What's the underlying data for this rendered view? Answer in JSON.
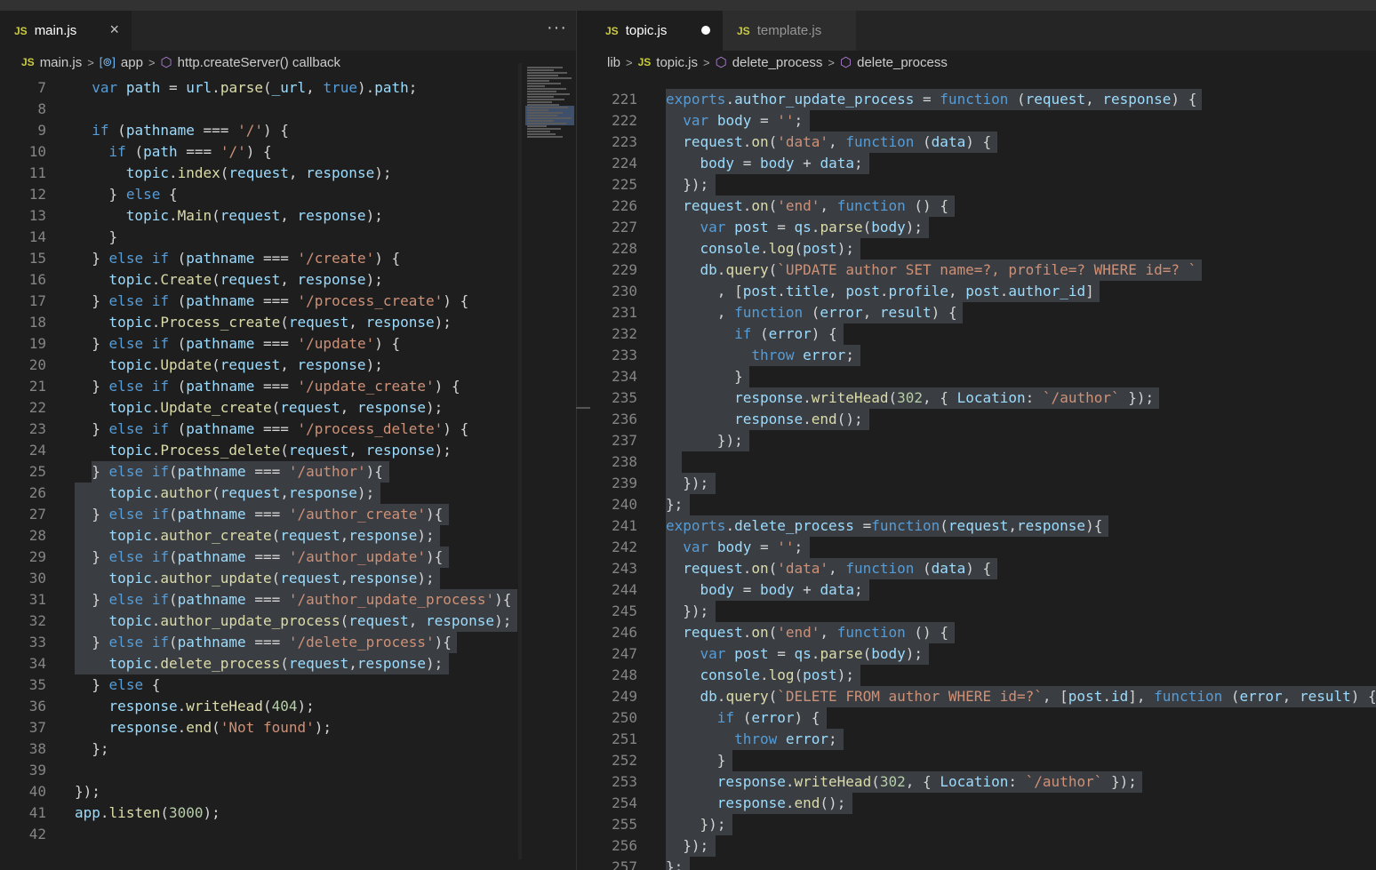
{
  "editor": {
    "left": {
      "tabs": [
        {
          "label": "main.js",
          "active": true,
          "icon": "js-file-icon",
          "close": "×"
        }
      ],
      "more_actions": "···",
      "breadcrumb": [
        "main.js",
        "app",
        "http.createServer() callback"
      ],
      "lines": [
        {
          "n": "7",
          "t": "  var path = url.parse(_url, true).path;"
        },
        {
          "n": "8",
          "t": ""
        },
        {
          "n": "9",
          "t": "  if (pathname === '/') {"
        },
        {
          "n": "10",
          "t": "    if (path === '/') {"
        },
        {
          "n": "11",
          "t": "      topic.index(request, response);"
        },
        {
          "n": "12",
          "t": "    } else {"
        },
        {
          "n": "13",
          "t": "      topic.Main(request, response);"
        },
        {
          "n": "14",
          "t": "    }"
        },
        {
          "n": "15",
          "t": "  } else if (pathname === '/create') {"
        },
        {
          "n": "16",
          "t": "    topic.Create(request, response);"
        },
        {
          "n": "17",
          "t": "  } else if (pathname === '/process_create') {"
        },
        {
          "n": "18",
          "t": "    topic.Process_create(request, response);"
        },
        {
          "n": "19",
          "t": "  } else if (pathname === '/update') {"
        },
        {
          "n": "20",
          "t": "    topic.Update(request, response);"
        },
        {
          "n": "21",
          "t": "  } else if (pathname === '/update_create') {"
        },
        {
          "n": "22",
          "t": "    topic.Update_create(request, response);"
        },
        {
          "n": "23",
          "t": "  } else if (pathname === '/process_delete') {"
        },
        {
          "n": "24",
          "t": "    topic.Process_delete(request, response);"
        },
        {
          "n": "25",
          "t": "  } else if(pathname === '/author'){"
        },
        {
          "n": "26",
          "t": "    topic.author(request,response);"
        },
        {
          "n": "27",
          "t": "  } else if(pathname === '/author_create'){"
        },
        {
          "n": "28",
          "t": "    topic.author_create(request,response);"
        },
        {
          "n": "29",
          "t": "  } else if(pathname === '/author_update'){"
        },
        {
          "n": "30",
          "t": "    topic.author_update(request,response);"
        },
        {
          "n": "31",
          "t": "  } else if(pathname === '/author_update_process'){"
        },
        {
          "n": "32",
          "t": "    topic.author_update_process(request, response);"
        },
        {
          "n": "33",
          "t": "  } else if(pathname === '/delete_process'){"
        },
        {
          "n": "34",
          "t": "    topic.delete_process(request,response);"
        },
        {
          "n": "35",
          "t": "  } else {"
        },
        {
          "n": "36",
          "t": "    response.writeHead(404);"
        },
        {
          "n": "37",
          "t": "    response.end('Not found');"
        },
        {
          "n": "38",
          "t": "  };"
        },
        {
          "n": "39",
          "t": ""
        },
        {
          "n": "40",
          "t": "});"
        },
        {
          "n": "41",
          "t": "app.listen(3000);"
        },
        {
          "n": "42",
          "t": ""
        }
      ]
    },
    "right": {
      "tabs": [
        {
          "label": "topic.js",
          "active": true,
          "icon": "js-file-icon",
          "dirty": true
        },
        {
          "label": "template.js",
          "active": false,
          "icon": "js-file-icon"
        }
      ],
      "breadcrumb": [
        "lib",
        "topic.js",
        "delete_process",
        "delete_process"
      ],
      "lines": [
        {
          "n": "221",
          "t": "exports.author_update_process = function (request, response) {"
        },
        {
          "n": "222",
          "t": "  var body = '';"
        },
        {
          "n": "223",
          "t": "  request.on('data', function (data) {"
        },
        {
          "n": "224",
          "t": "    body = body + data;"
        },
        {
          "n": "225",
          "t": "  });"
        },
        {
          "n": "226",
          "t": "  request.on('end', function () {"
        },
        {
          "n": "227",
          "t": "    var post = qs.parse(body);"
        },
        {
          "n": "228",
          "t": "    console.log(post);"
        },
        {
          "n": "229",
          "t": "    db.query(`UPDATE author SET name=?, profile=? WHERE id=? `"
        },
        {
          "n": "230",
          "t": "      , [post.title, post.profile, post.author_id]"
        },
        {
          "n": "231",
          "t": "      , function (error, result) {"
        },
        {
          "n": "232",
          "t": "        if (error) {"
        },
        {
          "n": "233",
          "t": "          throw error;"
        },
        {
          "n": "234",
          "t": "        }"
        },
        {
          "n": "235",
          "t": "        response.writeHead(302, { Location: `/author` });"
        },
        {
          "n": "236",
          "t": "        response.end();"
        },
        {
          "n": "237",
          "t": "      });"
        },
        {
          "n": "238",
          "t": ""
        },
        {
          "n": "239",
          "t": "  });"
        },
        {
          "n": "240",
          "t": "};"
        },
        {
          "n": "241",
          "t": "exports.delete_process =function(request,response){"
        },
        {
          "n": "242",
          "t": "  var body = '';"
        },
        {
          "n": "243",
          "t": "  request.on('data', function (data) {"
        },
        {
          "n": "244",
          "t": "    body = body + data;"
        },
        {
          "n": "245",
          "t": "  });"
        },
        {
          "n": "246",
          "t": "  request.on('end', function () {"
        },
        {
          "n": "247",
          "t": "    var post = qs.parse(body);"
        },
        {
          "n": "248",
          "t": "    console.log(post);"
        },
        {
          "n": "249",
          "t": "    db.query(`DELETE FROM author WHERE id=?`, [post.id], function (error, result) {"
        },
        {
          "n": "250",
          "t": "      if (error) {"
        },
        {
          "n": "251",
          "t": "        throw error;"
        },
        {
          "n": "252",
          "t": "      }"
        },
        {
          "n": "253",
          "t": "      response.writeHead(302, { Location: `/author` });"
        },
        {
          "n": "254",
          "t": "      response.end();"
        },
        {
          "n": "255",
          "t": "    });"
        },
        {
          "n": "256",
          "t": "  });"
        },
        {
          "n": "257",
          "t": "};"
        }
      ]
    }
  },
  "colors": {
    "keyword": "#569cd6",
    "string": "#ce9178",
    "number": "#b5cea8",
    "function": "#dcdcaa",
    "variable": "#9cdcfe",
    "selection": "#3a3d41"
  }
}
